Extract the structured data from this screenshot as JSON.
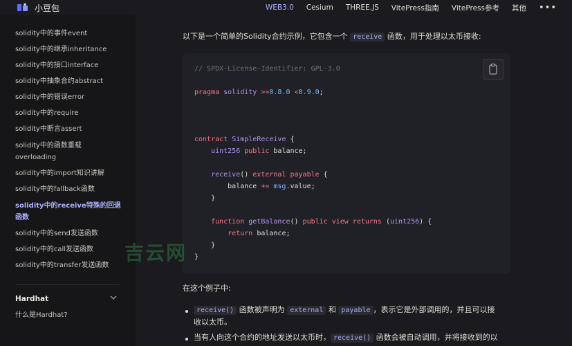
{
  "navbar": {
    "brand": "小豆包",
    "items": [
      {
        "label": "WEB3.0",
        "active": true
      },
      {
        "label": "Cesium",
        "active": false
      },
      {
        "label": "THREE.JS",
        "active": false
      },
      {
        "label": "VitePress指南",
        "active": false
      },
      {
        "label": "VitePress参考",
        "active": false
      },
      {
        "label": "其他",
        "active": false
      }
    ],
    "more": "•••"
  },
  "sidebar": {
    "items": [
      {
        "label": "solidity中的事件event"
      },
      {
        "label": "solidity中的继承inheritance"
      },
      {
        "label": "solidity中的接口interface"
      },
      {
        "label": "solidity中抽象合约abstract"
      },
      {
        "label": "solidity中的错误error"
      },
      {
        "label": "solidity中的require"
      },
      {
        "label": "solidity中断言assert"
      },
      {
        "label": "solidity中的函数重载",
        "label2": "overloading"
      },
      {
        "label": "solidity中的import知识讲解"
      },
      {
        "label": "solidity中的fallback函数"
      },
      {
        "label": "solidity中的receive特殊的回退",
        "label2": "函数",
        "active": true
      },
      {
        "label": "solidity中的send发送函数"
      },
      {
        "label": "solidity中的call发送函数"
      },
      {
        "label": "solidity中的transfer发送函数"
      }
    ],
    "section": "Hardhat",
    "section_item": "什么是Hardhat?"
  },
  "main": {
    "intro_a": "以下是一个简单的Solidity合约示例，它包含一个",
    "intro_code": "receive",
    "intro_b": "函数，用于处理以太币接收:",
    "code": {
      "l1": "// SPDX-License-Identifier: GPL-3.0",
      "l2_kw": "pragma",
      "l2_a": " solidity ",
      "l2_op1": ">=",
      "l2_v1": "0.8.0",
      "l2_op2": " <",
      "l2_v2": "0.9.0",
      "l2_end": ";",
      "l3_kw": "contract",
      "l3_name": " SimpleReceive",
      "l3_end": " {",
      "l4_ty": "    uint256",
      "l4_kw": " public",
      "l4_end": " balance;",
      "l5_fn": "    receive",
      "l5_a": "() ",
      "l5_kw": "external payable",
      "l5_end": " {",
      "l6_a": "        balance ",
      "l6_op": "+=",
      "l6_b": " msg",
      "l6_c": ".value;",
      "l7": "    }",
      "l8_kw": "    function",
      "l8_fn": " getBalance",
      "l8_a": "() ",
      "l8_kw2": "public view returns",
      "l8_b": " (",
      "l8_ty": "uint256",
      "l8_end": ") {",
      "l9_kw": "        return",
      "l9_end": " balance;",
      "l10": "    }",
      "l11": "}"
    },
    "example_heading": "在这个例子中:",
    "b1_code1": "receive()",
    "b1_a": "函数被声明为",
    "b1_code2": "external",
    "b1_b": "和",
    "b1_code3": "payable",
    "b1_c": "，表示它是外部调用的，并且可以接",
    "b1_line2": "收以太币。",
    "b2_a": "当有人向这个合约的地址发送以太币时，",
    "b2_code": "receive()",
    "b2_b": "函数会被自动调用，并将接收到的以",
    "watermark": "吉云网"
  }
}
